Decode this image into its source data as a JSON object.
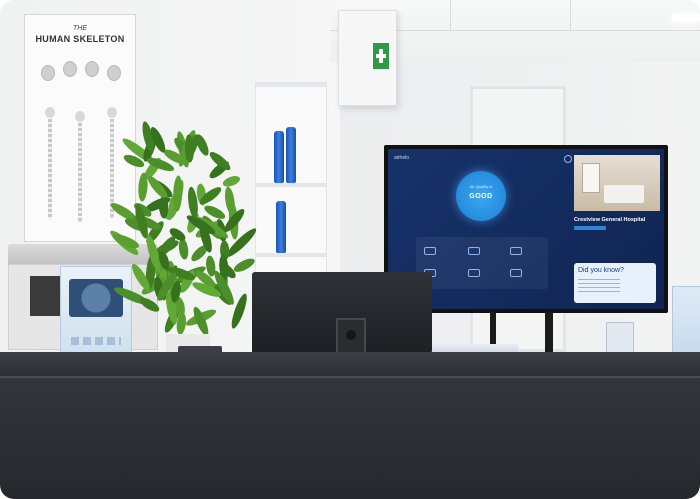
{
  "poster": {
    "subtitle": "THE",
    "title": "HUMAN SKELETON"
  },
  "tv_screen": {
    "brand": "airhelo",
    "status_small": "Air Quality is",
    "status": "GOOD",
    "hospital_name": "Crestview General Hospital",
    "did_you_know": "Did you know?"
  },
  "colors": {
    "counter": "#2f3338",
    "screen_bg": "#17336b",
    "status_circle": "#2a93e3",
    "first_aid": "#2e9a47"
  }
}
